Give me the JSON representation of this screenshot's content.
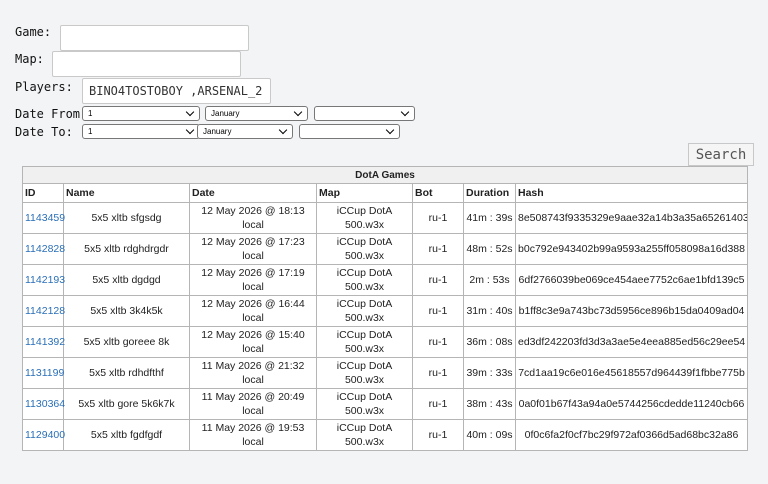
{
  "form": {
    "game_label": "Game:",
    "game_value": "",
    "map_label": "Map:",
    "map_value": "",
    "players_label": "Players:",
    "players_value": "BINO4TOSTOBOY ,ARSENAL_2",
    "date_from_label": "Date From:",
    "date_from": {
      "day": "1",
      "month": "January",
      "year": ""
    },
    "date_to_label": "Date To:",
    "date_to": {
      "day": "1",
      "month": "January",
      "year": ""
    },
    "search_label": "Search"
  },
  "table": {
    "caption": "DotA Games",
    "columns": [
      "ID",
      "Name",
      "Date",
      "Map",
      "Bot",
      "Duration",
      "Hash"
    ],
    "rows": [
      {
        "id": "1143459",
        "name": "5x5 xltb sfgsdg",
        "date": "12 May 2026 @ 18:13 local",
        "map": "iCCup DotA 500.w3x",
        "bot": "ru-1",
        "duration": "41m : 39s",
        "hash": "8e508743f9335329e9aae32a14b3a35a65261403"
      },
      {
        "id": "1142828",
        "name": "5x5 xltb rdghdrgdr",
        "date": "12 May 2026 @ 17:23 local",
        "map": "iCCup DotA 500.w3x",
        "bot": "ru-1",
        "duration": "48m : 52s",
        "hash": "b0c792e943402b99a9593a255ff058098a16d388"
      },
      {
        "id": "1142193",
        "name": "5x5 xltb dgdgd",
        "date": "12 May 2026 @ 17:19 local",
        "map": "iCCup DotA 500.w3x",
        "bot": "ru-1",
        "duration": "2m : 53s",
        "hash": "6df2766039be069ce454aee7752c6ae1bfd139c5"
      },
      {
        "id": "1142128",
        "name": "5x5 xltb 3k4k5k",
        "date": "12 May 2026 @ 16:44 local",
        "map": "iCCup DotA 500.w3x",
        "bot": "ru-1",
        "duration": "31m : 40s",
        "hash": "b1ff8c3e9a743bc73d5956ce896b15da0409ad04"
      },
      {
        "id": "1141392",
        "name": "5x5 xltb goreee 8k",
        "date": "12 May 2026 @ 15:40 local",
        "map": "iCCup DotA 500.w3x",
        "bot": "ru-1",
        "duration": "36m : 08s",
        "hash": "ed3df242203fd3d3a3ae5e4eea885ed56c29ee54"
      },
      {
        "id": "1131199",
        "name": "5x5 xltb rdhdfthf",
        "date": "11 May 2026 @ 21:32 local",
        "map": "iCCup DotA 500.w3x",
        "bot": "ru-1",
        "duration": "39m : 33s",
        "hash": "7cd1aa19c6e016e45618557d964439f1fbbe775b"
      },
      {
        "id": "1130364",
        "name": "5x5 xltb gore 5k6k7k",
        "date": "11 May 2026 @ 20:49 local",
        "map": "iCCup DotA 500.w3x",
        "bot": "ru-1",
        "duration": "38m : 43s",
        "hash": "0a0f01b67f43a94a0e5744256cdedde11240cb66"
      },
      {
        "id": "1129400",
        "name": "5x5 xltb fgdfgdf",
        "date": "11 May 2026 @ 19:53 local",
        "map": "iCCup DotA 500.w3x",
        "bot": "ru-1",
        "duration": "40m : 09s",
        "hash": "0f0c6fa2f0cf7bc29f972af0366d5ad68bc32a86"
      }
    ]
  }
}
